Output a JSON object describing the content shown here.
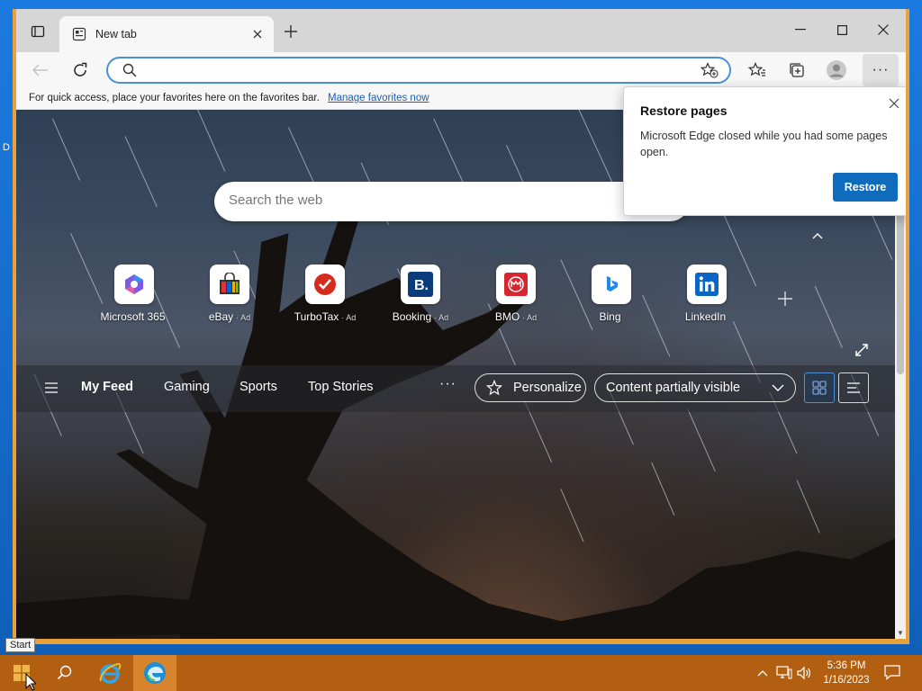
{
  "desktop": {
    "side_letter": "D"
  },
  "browser": {
    "tab": {
      "title": "New tab"
    },
    "address": {
      "value": "",
      "placeholder": ""
    },
    "favbar": {
      "text": "For quick access, place your favorites here on the favorites bar.",
      "link": "Manage favorites now"
    },
    "search": {
      "placeholder": "Search the web"
    },
    "tiles": [
      {
        "name": "Microsoft 365",
        "ad": "",
        "icon": "microsoft365-icon"
      },
      {
        "name": "eBay",
        "ad": "· Ad",
        "icon": "ebay-icon"
      },
      {
        "name": "TurboTax",
        "ad": "· Ad",
        "icon": "turbotax-icon"
      },
      {
        "name": "Booking",
        "ad": "· Ad",
        "icon": "booking-icon"
      },
      {
        "name": "BMO",
        "ad": "· Ad",
        "icon": "bmo-icon"
      },
      {
        "name": "Bing",
        "ad": "",
        "icon": "bing-icon"
      },
      {
        "name": "LinkedIn",
        "ad": "",
        "icon": "linkedin-icon"
      }
    ],
    "feed": {
      "tabs": [
        "My Feed",
        "Gaming",
        "Sports",
        "Top Stories"
      ],
      "more": "···",
      "personalize": "Personalize",
      "content_select": "Content partially visible"
    },
    "popup": {
      "title": "Restore pages",
      "body": "Microsoft Edge closed while you had some pages open.",
      "button": "Restore"
    }
  },
  "taskbar": {
    "tooltip": "Start",
    "time": "5:36 PM",
    "date": "1/16/2023"
  },
  "colors": {
    "accent": "#0f6cbd",
    "taskbar": "#b35f12",
    "window_frame": "#e8a13c"
  }
}
